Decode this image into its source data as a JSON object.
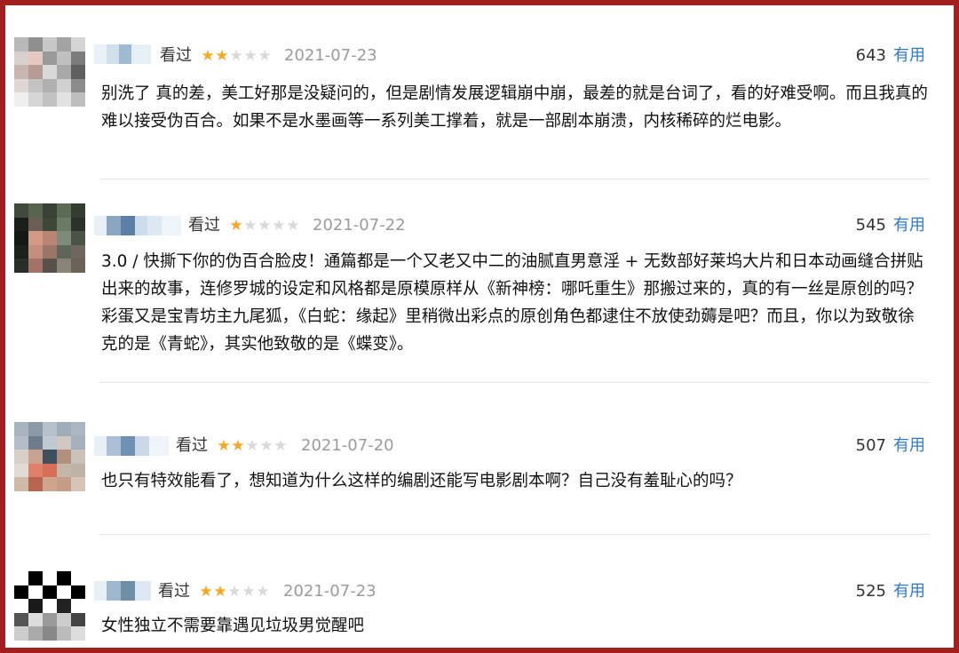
{
  "comments": [
    {
      "status": "看过",
      "rating": 2,
      "date": "2021-07-23",
      "votes": "643",
      "useful_label": "有用",
      "text": "别洗了 真的差，美工好那是没疑问的，但是剧情发展逻辑崩中崩，最差的就是台词了，看的好难受啊。而且我真的难以接受伪百合。如果不是水墨画等一系列美工撑着，就是一部剧本崩溃，内核稀碎的烂电影。"
    },
    {
      "status": "看过",
      "rating": 1,
      "date": "2021-07-22",
      "votes": "545",
      "useful_label": "有用",
      "text": "3.0 / 快撕下你的伪百合脸皮！通篇都是一个又老又中二的油腻直男意淫 + 无数部好莱坞大片和日本动画缝合拼贴出来的故事，连修罗城的设定和风格都是原模原样从《新神榜：哪吒重生》那搬过来的，真的有一丝是原创的吗？彩蛋又是宝青坊主九尾狐，《白蛇：缘起》里稍微出彩点的原创角色都逮住不放使劲薅是吧？而且，你以为致敬徐克的是《青蛇》，其实他致敬的是《蝶变》。"
    },
    {
      "status": "看过",
      "rating": 2,
      "date": "2021-07-20",
      "votes": "507",
      "useful_label": "有用",
      "text": "也只有特效能看了，想知道为什么这样的编剧还能写电影剧本啊？自己没有羞耻心的吗？"
    },
    {
      "status": "看过",
      "rating": 2,
      "date": "2021-07-23",
      "votes": "525",
      "useful_label": "有用",
      "text": "女性独立不需要靠遇见垃圾男觉醒吧"
    }
  ],
  "colors": {
    "frame": "#a31f1f",
    "star_on": "#f5a623",
    "star_off": "#d9d9d9",
    "useful_link": "#2f7bc4",
    "date": "#9b9b9b"
  }
}
